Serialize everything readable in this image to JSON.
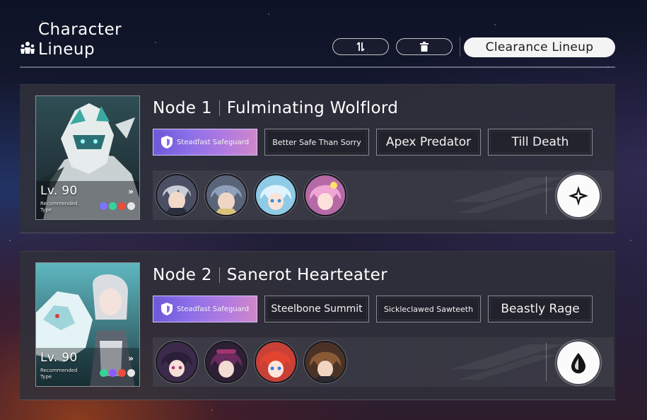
{
  "header": {
    "title_line1": "Character",
    "title_line2": "Lineup",
    "icon": "team-icon",
    "swap_icon": "swap-icon",
    "delete_icon": "trash-icon",
    "clearance_label": "Clearance Lineup"
  },
  "nodes": [
    {
      "node_label": "Node 1",
      "enemy_name": "Fulminating Wolflord",
      "level": "Lv. 90",
      "recommended_line1": "Recommended",
      "recommended_line2": "Type",
      "recommended_types": [
        "imaginary",
        "wind",
        "fire",
        "physical"
      ],
      "buff_tag": "Steadfast Safeguard",
      "tags": [
        "Better Safe Than Sorry",
        "Apex Predator",
        "Till Death"
      ],
      "team": [
        "character-avatar-1",
        "character-avatar-2",
        "character-avatar-3",
        "character-avatar-4"
      ],
      "weakness_icon": "physical-weakness-icon",
      "colors": {
        "portrait": "#2c4a4c"
      }
    },
    {
      "node_label": "Node 2",
      "enemy_name": "Sanerot Hearteater",
      "level": "Lv. 90",
      "recommended_line1": "Recommended",
      "recommended_line2": "Type",
      "recommended_types": [
        "wind",
        "quantum",
        "fire",
        "physical"
      ],
      "buff_tag": "Steadfast Safeguard",
      "tags": [
        "Steelbone Summit",
        "Sickleclawed Sawteeth",
        "Beastly Rage"
      ],
      "team": [
        "character-avatar-1",
        "character-avatar-2",
        "character-avatar-3",
        "character-avatar-4"
      ],
      "weakness_icon": "drop-weakness-icon",
      "colors": {
        "portrait": "#3f7f86"
      }
    }
  ],
  "colors": {
    "buff_gradient_start": "#6b57d8",
    "buff_gradient_end": "#cf86c8",
    "imaginary": "#7d73ff",
    "wind": "#35d39a",
    "fire": "#ef4a3a",
    "quantum": "#8a5cff",
    "physical": "#e6e6e6"
  }
}
